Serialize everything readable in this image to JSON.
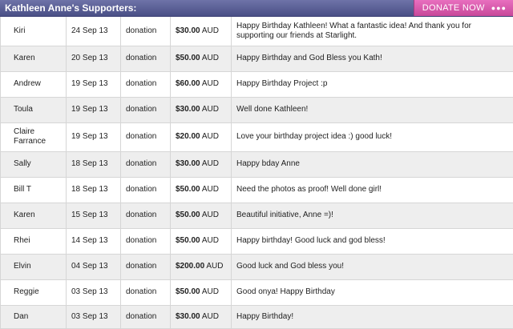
{
  "header": {
    "title": "Kathleen Anne's Supporters:",
    "donate_label": "DONATE NOW",
    "donate_dots": "●●●"
  },
  "supporters": [
    {
      "name": "Kiri",
      "date": "24 Sep 13",
      "type": "donation",
      "amount": "$30.00",
      "currency": "AUD",
      "message": "Happy Birthday Kathleen! What a fantastic idea! And thank you for supporting our friends at Starlight."
    },
    {
      "name": "Karen",
      "date": "20 Sep 13",
      "type": "donation",
      "amount": "$50.00",
      "currency": "AUD",
      "message": "Happy Birthday and God Bless you Kath!"
    },
    {
      "name": "Andrew",
      "date": "19 Sep 13",
      "type": "donation",
      "amount": "$60.00",
      "currency": "AUD",
      "message": "Happy Birthday Project :p"
    },
    {
      "name": "Toula",
      "date": "19 Sep 13",
      "type": "donation",
      "amount": "$30.00",
      "currency": "AUD",
      "message": "Well done Kathleen!"
    },
    {
      "name": "Claire Farrance",
      "date": "19 Sep 13",
      "type": "donation",
      "amount": "$20.00",
      "currency": "AUD",
      "message": "Love your birthday project idea :) good luck!"
    },
    {
      "name": "Sally",
      "date": "18 Sep 13",
      "type": "donation",
      "amount": "$30.00",
      "currency": "AUD",
      "message": "Happy bday Anne"
    },
    {
      "name": "Bill T",
      "date": "18 Sep 13",
      "type": "donation",
      "amount": "$50.00",
      "currency": "AUD",
      "message": "Need the photos as proof! Well done girl!"
    },
    {
      "name": "Karen",
      "date": "15 Sep 13",
      "type": "donation",
      "amount": "$50.00",
      "currency": "AUD",
      "message": "Beautiful initiative, Anne =)!"
    },
    {
      "name": "Rhei",
      "date": "14 Sep 13",
      "type": "donation",
      "amount": "$50.00",
      "currency": "AUD",
      "message": "Happy birthday! Good luck and god bless!"
    },
    {
      "name": "Elvin",
      "date": "04 Sep 13",
      "type": "donation",
      "amount": "$200.00",
      "currency": "AUD",
      "message": "Good luck and God bless you!"
    },
    {
      "name": "Reggie",
      "date": "03 Sep 13",
      "type": "donation",
      "amount": "$50.00",
      "currency": "AUD",
      "message": "Good onya! Happy Birthday"
    },
    {
      "name": "Dan",
      "date": "03 Sep 13",
      "type": "donation",
      "amount": "$30.00",
      "currency": "AUD",
      "message": "Happy Birthday!"
    }
  ]
}
